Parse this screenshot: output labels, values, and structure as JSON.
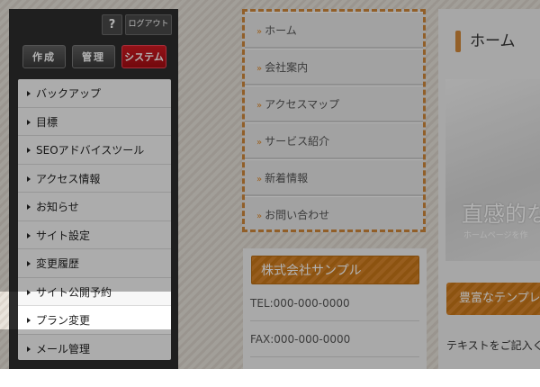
{
  "site": {
    "nav_items": [
      "ホーム",
      "会社案内",
      "アクセスマップ",
      "サービス紹介",
      "新着情報",
      "お問い合わせ"
    ],
    "nav_arrow": "»",
    "company_title": "株式会社サンプル",
    "tel": "TEL:000-000-0000",
    "fax": "FAX:000-000-0000",
    "page_heading": "ホーム",
    "hero_title": "直感的な",
    "hero_sub": "ホームページを作",
    "rich_button": "豊富なテンプレ",
    "body_text": "テキストをご記入くだ"
  },
  "admin": {
    "help": "?",
    "logout": "ログアウト",
    "tabs": [
      "作成",
      "管理",
      "システム"
    ],
    "active_tab": "システム",
    "menu": [
      "バックアップ",
      "目標",
      "SEOアドバイスツール",
      "アクセス情報",
      "お知らせ",
      "サイト設定",
      "変更履歴",
      "サイト公開予約",
      "プラン変更",
      "メール管理"
    ],
    "highlighted": "プラン変更"
  },
  "colors": {
    "accent": "#d8862b",
    "active_tab": "#c4141b",
    "sidebar": "#2d2d2d"
  }
}
